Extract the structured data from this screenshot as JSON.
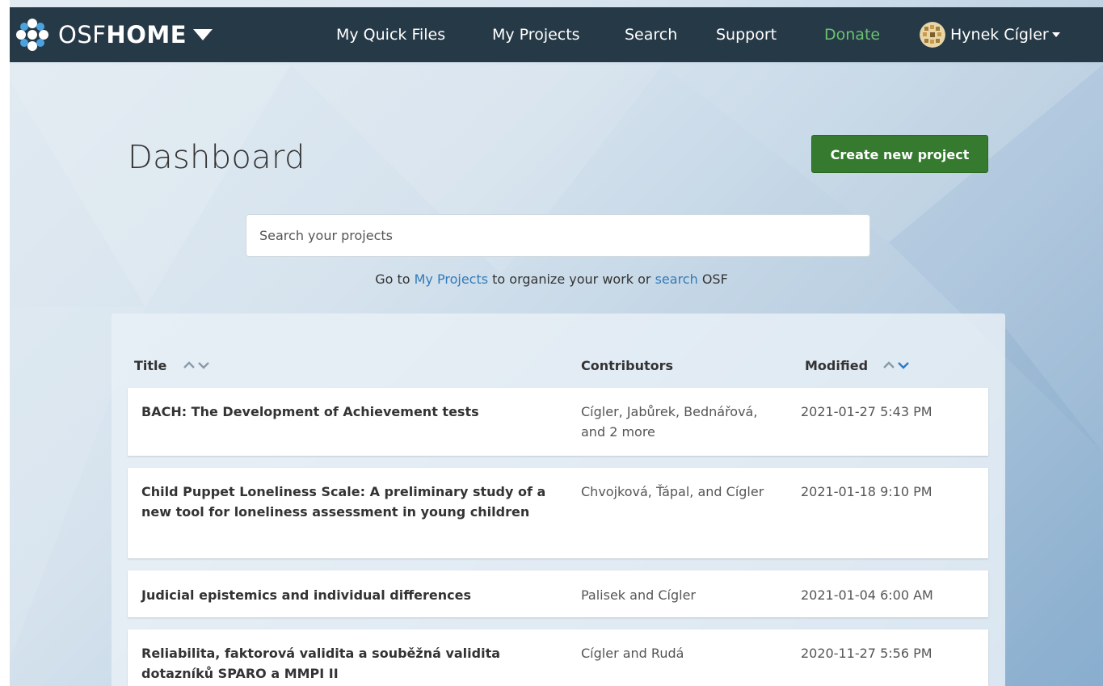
{
  "navbar": {
    "brand_osf": "OSF",
    "brand_home": "HOME",
    "links": {
      "quick_files": "My Quick Files",
      "projects": "My Projects",
      "search": "Search",
      "support": "Support",
      "donate": "Donate"
    },
    "user_name": "Hynek Cígler"
  },
  "dashboard": {
    "title": "Dashboard",
    "create_label": "Create new project",
    "search_placeholder": "Search your projects",
    "hint_prefix": "Go to ",
    "hint_link_projects": "My Projects",
    "hint_middle": " to organize your work or ",
    "hint_link_search": "search",
    "hint_suffix": " OSF"
  },
  "table": {
    "columns": {
      "title": "Title",
      "contributors": "Contributors",
      "modified": "Modified"
    },
    "rows": [
      {
        "title": "BACH: The Development of Achievement tests",
        "contributors": "Cígler, Jabůrek, Bednářová, and 2 more",
        "modified": "2021-01-27 5:43 PM"
      },
      {
        "title": "Child Puppet Loneliness Scale: A preliminary study of a new tool for loneliness assessment in young children",
        "contributors": "Chvojková, Ťápal, and Cígler",
        "modified": "2021-01-18 9:10 PM"
      },
      {
        "title": "Judicial epistemics and individual differences",
        "contributors": "Palisek and Cígler",
        "modified": "2021-01-04 6:00 AM"
      },
      {
        "title": "Reliabilita, faktorová validita a souběžná validita dotazníků SPARO a MMPI II",
        "contributors": "Cígler and Rudá",
        "modified": "2020-11-27 5:56 PM"
      }
    ]
  },
  "colors": {
    "navbar_bg": "#263947",
    "donate": "#6ac271",
    "create_button": "#357a2e",
    "link": "#337ab7",
    "sort_active": "#2d7ac6",
    "sort_inactive": "#8a9aa8"
  },
  "icons": {
    "logo": "osf-logo-icon",
    "brand_caret": "caret-down-icon",
    "avatar": "user-avatar-icon",
    "user_caret": "caret-down-icon",
    "sort": "chevron-up-down-icon"
  }
}
